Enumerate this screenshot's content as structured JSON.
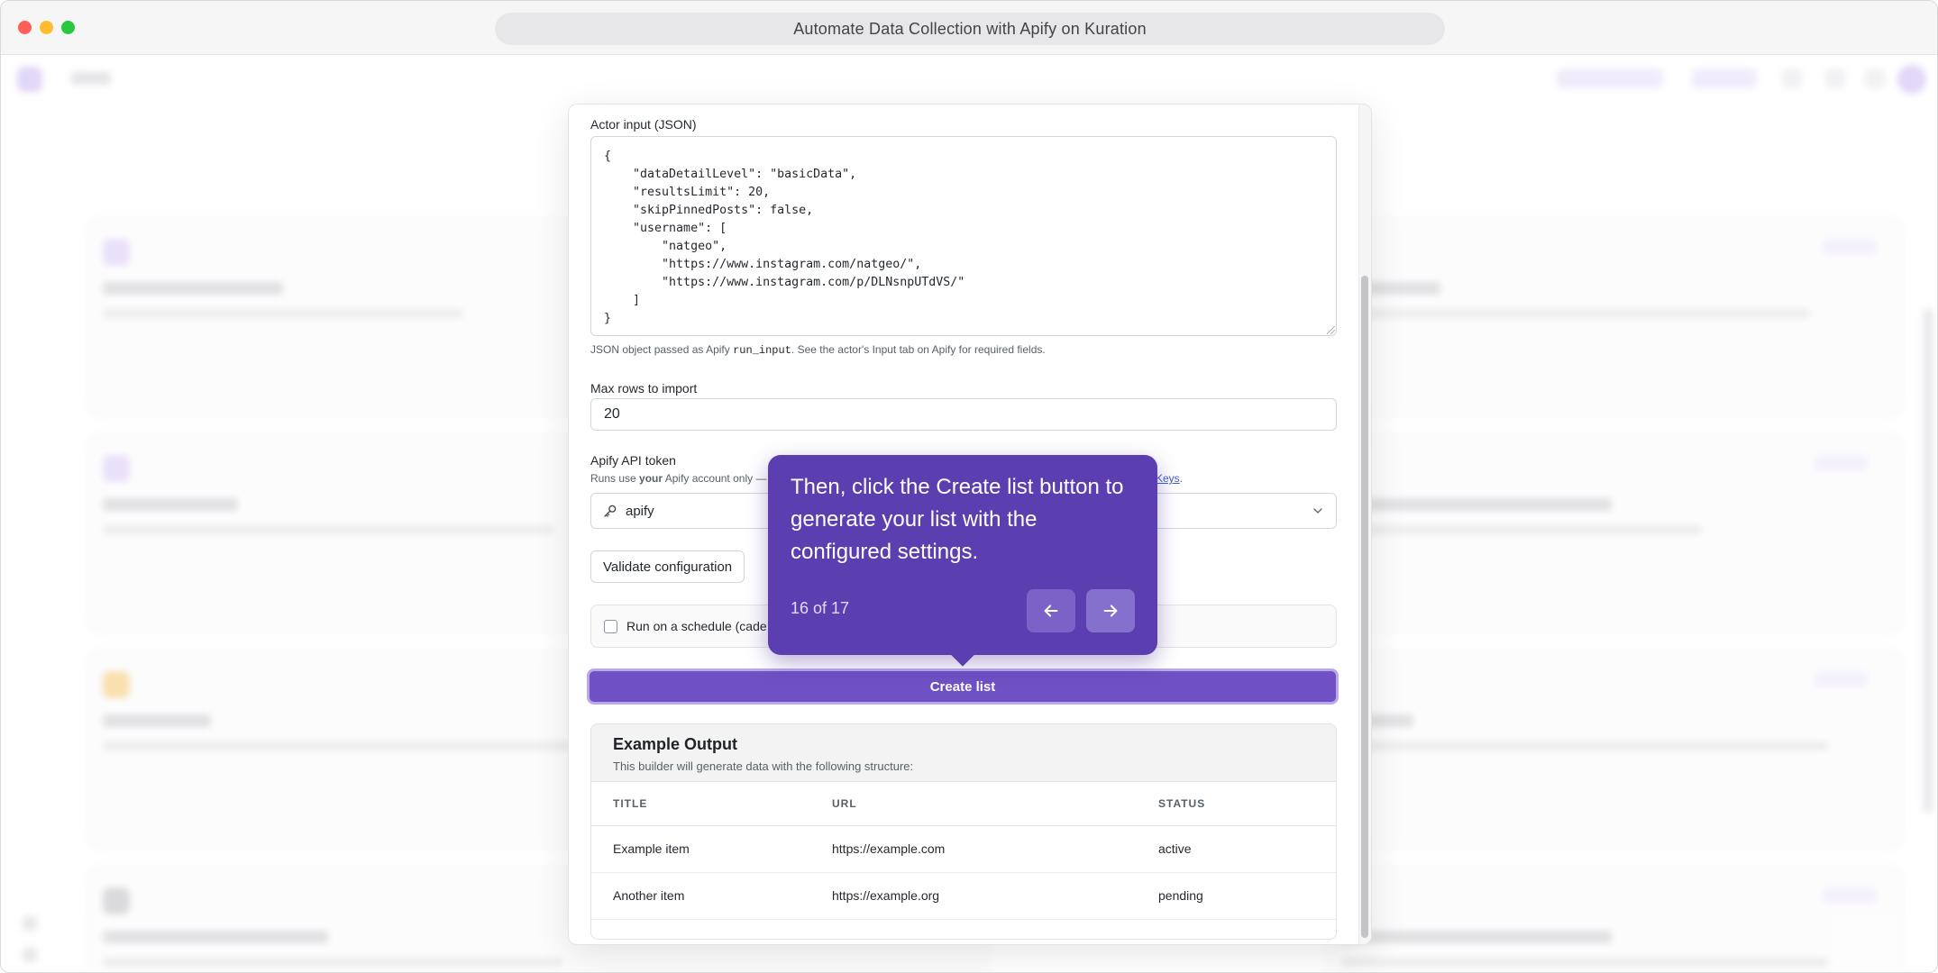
{
  "window": {
    "title": "Automate Data Collection with Apify on Kuration"
  },
  "form": {
    "actor_input_label": "Actor input (JSON)",
    "actor_input_value": "{\n    \"dataDetailLevel\": \"basicData\",\n    \"resultsLimit\": 20,\n    \"skipPinnedPosts\": false,\n    \"username\": [\n        \"natgeo\",\n        \"https://www.instagram.com/natgeo/\",\n        \"https://www.instagram.com/p/DLNsnpUTdVS/\"\n    ]\n}",
    "actor_input_help_prefix": "JSON object passed as Apify ",
    "actor_input_help_code": "run_input",
    "actor_input_help_suffix": ". See the actor's Input tab on Apify for required fields.",
    "max_rows_label": "Max rows to import",
    "max_rows_value": "20",
    "token_label": "Apify API token",
    "token_help_prefix": "Runs use ",
    "token_help_bold": "your",
    "token_help_suffix": " Apify account only —",
    "token_help_link": "Keys",
    "token_help_end": ".",
    "token_selected": "apify",
    "validate_label": "Validate configuration",
    "schedule_label": "Run on a schedule (cade",
    "create_label": "Create list"
  },
  "example_output": {
    "title": "Example Output",
    "subtitle": "This builder will generate data with the following structure:",
    "columns": [
      "TITLE",
      "URL",
      "STATUS"
    ],
    "rows": [
      [
        "Example item",
        "https://example.com",
        "active"
      ],
      [
        "Another item",
        "https://example.org",
        "pending"
      ]
    ]
  },
  "tour": {
    "message": "Then, click the Create list button to generate your list with the configured settings.",
    "progress": "16 of 17",
    "prev_icon": "arrow-left-icon",
    "next_icon": "arrow-right-icon"
  },
  "colors": {
    "accent": "#6f51c4",
    "popover": "#5b3fb0",
    "link": "#3b5bdb"
  }
}
